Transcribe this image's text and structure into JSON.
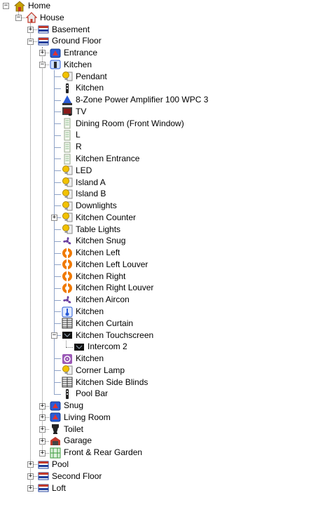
{
  "tree": [
    {
      "label": "Home",
      "level": 0,
      "icon": "home-shield-icon",
      "expander": "minus",
      "color": "#c8a000"
    },
    {
      "label": "House",
      "level": 1,
      "icon": "house-icon",
      "expander": "minus",
      "color": "#c0392b"
    },
    {
      "label": "Basement",
      "level": 2,
      "icon": "floor-icon",
      "expander": "plus",
      "color": "#c0392b"
    },
    {
      "label": "Ground Floor",
      "level": 2,
      "icon": "floor-icon",
      "expander": "minus",
      "color": "#c0392b"
    },
    {
      "label": "Entrance",
      "level": 3,
      "icon": "room-icon",
      "expander": "plus",
      "color": "#2a5bd7"
    },
    {
      "label": "Kitchen",
      "level": 3,
      "icon": "kitchen-room-icon",
      "expander": "minus",
      "color": "#2a5bd7"
    },
    {
      "label": "Pendant",
      "level": 4,
      "icon": "light-icon",
      "expander": "none",
      "color": "#f2c200"
    },
    {
      "label": "Kitchen",
      "level": 4,
      "icon": "keypad-icon",
      "expander": "none",
      "color": "#222222"
    },
    {
      "label": "8-Zone Power Amplifier 100 WPC 3",
      "level": 4,
      "icon": "amplifier-icon",
      "expander": "none",
      "color": "#2a5bd7"
    },
    {
      "label": "TV",
      "level": 4,
      "icon": "tv-icon",
      "expander": "none",
      "color": "#444444"
    },
    {
      "label": "Dining Room (Front Window)",
      "level": 4,
      "icon": "speaker-icon",
      "expander": "none",
      "color": "#8fbf8f"
    },
    {
      "label": "L",
      "level": 4,
      "icon": "speaker-icon",
      "expander": "none",
      "color": "#8fbf8f"
    },
    {
      "label": "R",
      "level": 4,
      "icon": "speaker-icon",
      "expander": "none",
      "color": "#8fbf8f"
    },
    {
      "label": "Kitchen Entrance",
      "level": 4,
      "icon": "speaker-icon",
      "expander": "none",
      "color": "#8fbf8f"
    },
    {
      "label": "LED",
      "level": 4,
      "icon": "light-icon",
      "expander": "none",
      "color": "#f2c200"
    },
    {
      "label": "Island A",
      "level": 4,
      "icon": "light-icon",
      "expander": "none",
      "color": "#f2c200"
    },
    {
      "label": "Island B",
      "level": 4,
      "icon": "light-icon",
      "expander": "none",
      "color": "#f2c200"
    },
    {
      "label": "Downlights",
      "level": 4,
      "icon": "light-icon",
      "expander": "none",
      "color": "#f2c200"
    },
    {
      "label": "Kitchen Counter",
      "level": 4,
      "icon": "light-icon",
      "expander": "plus",
      "color": "#f2c200"
    },
    {
      "label": "Table Lights",
      "level": 4,
      "icon": "light-icon",
      "expander": "none",
      "color": "#f2c200"
    },
    {
      "label": "Kitchen Snug",
      "level": 4,
      "icon": "fan-icon",
      "expander": "none",
      "color": "#6a3fa0"
    },
    {
      "label": "Kitchen Left",
      "level": 4,
      "icon": "shade-icon",
      "expander": "none",
      "color": "#f07a00"
    },
    {
      "label": "Kitchen Left Louver",
      "level": 4,
      "icon": "shade-icon",
      "expander": "none",
      "color": "#f07a00"
    },
    {
      "label": "Kitchen Right",
      "level": 4,
      "icon": "shade-icon",
      "expander": "none",
      "color": "#f07a00"
    },
    {
      "label": "Kitchen Right Louver",
      "level": 4,
      "icon": "shade-icon",
      "expander": "none",
      "color": "#f07a00"
    },
    {
      "label": "Kitchen Aircon",
      "level": 4,
      "icon": "fan-icon",
      "expander": "none",
      "color": "#6a3fa0"
    },
    {
      "label": "Kitchen",
      "level": 4,
      "icon": "thermostat-icon",
      "expander": "none",
      "color": "#2a5bd7"
    },
    {
      "label": "Kitchen Curtain",
      "level": 4,
      "icon": "curtain-icon",
      "expander": "none",
      "color": "#333333"
    },
    {
      "label": "Kitchen Touchscreen",
      "level": 4,
      "icon": "touchscreen-icon",
      "expander": "minus",
      "color": "#111111"
    },
    {
      "label": "Intercom 2",
      "level": 5,
      "icon": "touchscreen-icon",
      "expander": "none",
      "color": "#111111"
    },
    {
      "label": "Kitchen",
      "level": 4,
      "icon": "media-icon",
      "expander": "none",
      "color": "#9b59b6"
    },
    {
      "label": "Corner Lamp",
      "level": 4,
      "icon": "light-icon",
      "expander": "none",
      "color": "#f2c200"
    },
    {
      "label": "Kitchen Side Blinds",
      "level": 4,
      "icon": "curtain-icon",
      "expander": "none",
      "color": "#333333"
    },
    {
      "label": "Pool Bar",
      "level": 4,
      "icon": "keypad-icon",
      "expander": "none",
      "color": "#222222"
    },
    {
      "label": "Snug",
      "level": 3,
      "icon": "room-icon",
      "expander": "plus",
      "color": "#2a5bd7"
    },
    {
      "label": "Living Room",
      "level": 3,
      "icon": "room-icon",
      "expander": "plus",
      "color": "#2a5bd7"
    },
    {
      "label": "Toilet",
      "level": 3,
      "icon": "toilet-icon",
      "expander": "plus",
      "color": "#222222"
    },
    {
      "label": "Garage",
      "level": 3,
      "icon": "garage-icon",
      "expander": "plus",
      "color": "#c0392b"
    },
    {
      "label": "Front & Rear Garden",
      "level": 3,
      "icon": "garden-icon",
      "expander": "plus",
      "color": "#3a9a3a"
    },
    {
      "label": "Pool",
      "level": 2,
      "icon": "floor-icon",
      "expander": "plus",
      "color": "#c0392b"
    },
    {
      "label": "Second Floor",
      "level": 2,
      "icon": "floor-icon",
      "expander": "plus",
      "color": "#c0392b"
    },
    {
      "label": "Loft",
      "level": 2,
      "icon": "floor-icon",
      "expander": "plus",
      "color": "#c0392b"
    }
  ]
}
